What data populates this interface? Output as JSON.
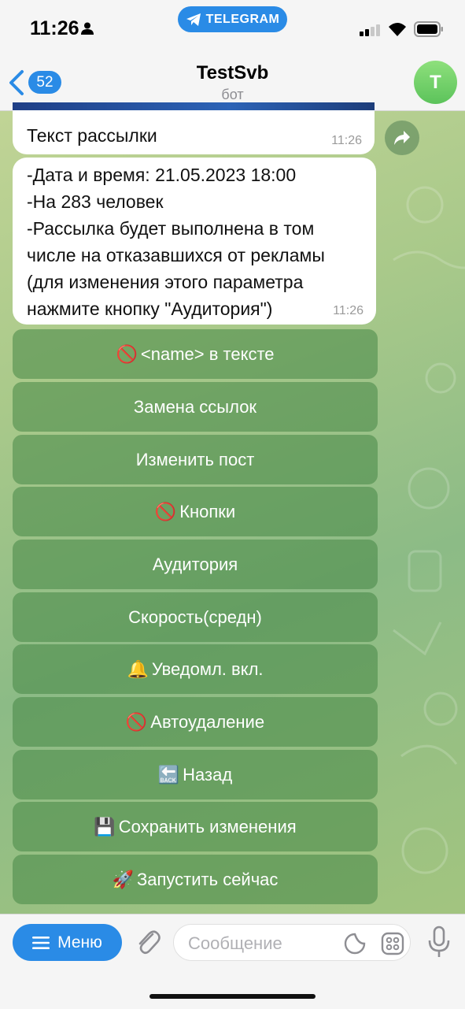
{
  "status_bar": {
    "time": "11:26",
    "return_to_app": "TELEGRAM"
  },
  "header": {
    "back_badge": "52",
    "title": "TestSvb",
    "subtitle": "бот",
    "avatar_letter": "T"
  },
  "messages": [
    {
      "text": "Текст рассылки",
      "time": "11:26"
    },
    {
      "lines": [
        "-Дата и время: 21.05.2023 18:00",
        "-На 283 человек",
        "-Рассылка будет выполнена в том",
        "числе на отказавшихся от рекламы",
        "(для изменения этого параметра",
        "нажмите кнопку \"Аудитория\")"
      ],
      "time": "11:26"
    }
  ],
  "inline_keyboard": [
    {
      "emoji": "🚫",
      "label": "<name> в тексте"
    },
    {
      "emoji": "",
      "label": "Замена ссылок"
    },
    {
      "emoji": "",
      "label": "Изменить пост"
    },
    {
      "emoji": "🚫",
      "label": "Кнопки"
    },
    {
      "emoji": "",
      "label": "Аудитория"
    },
    {
      "emoji": "",
      "label": "Скорость(средн)"
    },
    {
      "emoji": "🔔",
      "label": "Уведомл. вкл."
    },
    {
      "emoji": "🚫",
      "label": "Автоудаление"
    },
    {
      "emoji": "🔙",
      "label": "Назад"
    },
    {
      "emoji": "💾",
      "label": "Сохранить изменения"
    },
    {
      "emoji": "🚀",
      "label": "Запустить сейчас"
    }
  ],
  "composer": {
    "menu_label": "Меню",
    "placeholder": "Сообщение",
    "value": ""
  },
  "colors": {
    "accent": "#2a8be6",
    "keyboard_button": "#5e9a5a",
    "avatar": "#6fcf6a"
  },
  "icons": [
    "person-icon",
    "telegram-icon",
    "signal-icon",
    "wifi-icon",
    "battery-icon",
    "back-chevron-icon",
    "share-icon",
    "hamburger-icon",
    "attach-icon",
    "sticker-icon",
    "bot-commands-icon",
    "mic-icon"
  ]
}
